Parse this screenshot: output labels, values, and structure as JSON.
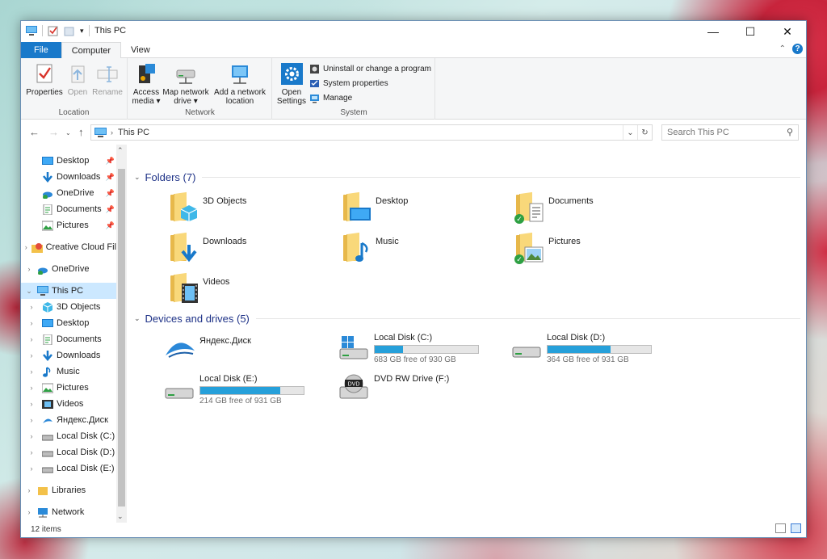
{
  "window": {
    "title": "This PC"
  },
  "ribbon_tabs": {
    "file": "File",
    "computer": "Computer",
    "view": "View"
  },
  "ribbon": {
    "location": {
      "label": "Location",
      "properties": "Properties",
      "open": "Open",
      "rename": "Rename"
    },
    "network": {
      "label": "Network",
      "access_media": "Access media",
      "map_drive": "Map network drive",
      "add_location": "Add a network location"
    },
    "system": {
      "label": "System",
      "open_settings": "Open Settings",
      "uninstall": "Uninstall or change a program",
      "system_properties": "System properties",
      "manage": "Manage"
    }
  },
  "address": {
    "crumb": "This PC",
    "search_placeholder": "Search This PC"
  },
  "nav": {
    "quick_access": [
      "Desktop",
      "Downloads",
      "OneDrive",
      "Documents",
      "Pictures"
    ],
    "creative_cloud": "Creative Cloud Fil",
    "onedrive": "OneDrive",
    "this_pc": "This PC",
    "this_pc_children": [
      "3D Objects",
      "Desktop",
      "Documents",
      "Downloads",
      "Music",
      "Pictures",
      "Videos",
      "Яндекс.Диск",
      "Local Disk (C:)",
      "Local Disk (D:)",
      "Local Disk (E:)"
    ],
    "libraries": "Libraries",
    "network": "Network"
  },
  "folders_section": "Folders (7)",
  "folders": [
    "3D Objects",
    "Desktop",
    "Documents",
    "Downloads",
    "Music",
    "Pictures",
    "Videos"
  ],
  "devices_section": "Devices and drives (5)",
  "drives": {
    "yandex": {
      "name": "Яндекс.Диск"
    },
    "c": {
      "name": "Local Disk (C:)",
      "free": "683 GB free of 930 GB",
      "used_fraction": 0.27
    },
    "d": {
      "name": "Local Disk (D:)",
      "free": "364 GB free of 931 GB",
      "used_fraction": 0.61
    },
    "e": {
      "name": "Local Disk (E:)",
      "free": "214 GB free of 931 GB",
      "used_fraction": 0.77
    },
    "f": {
      "name": "DVD RW Drive (F:)"
    }
  },
  "status": {
    "items": "12 items"
  },
  "colors": {
    "accent": "#1979ca",
    "selection": "#cce8ff",
    "bar_fill": "#26a0da"
  }
}
